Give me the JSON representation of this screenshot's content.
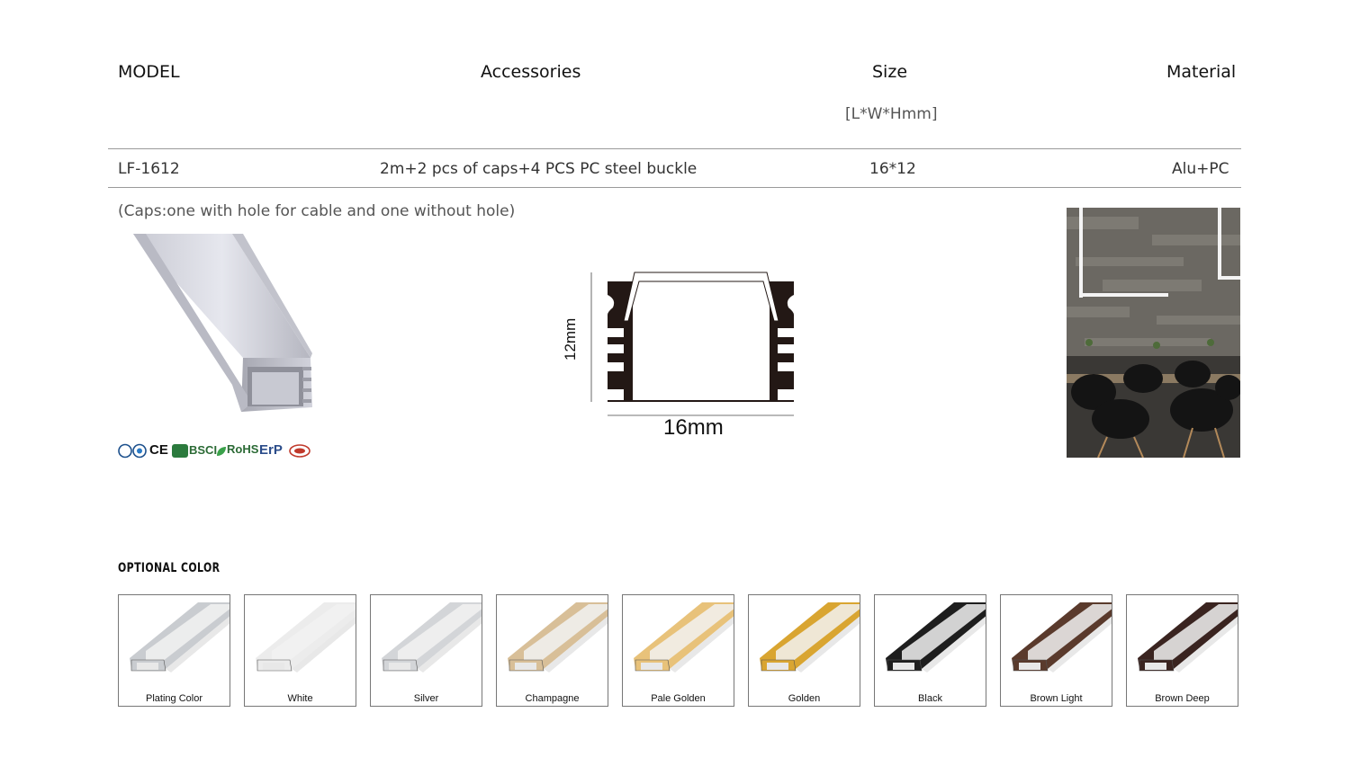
{
  "table": {
    "headers": {
      "model": "MODEL",
      "accessories": "Accessories",
      "size": "Size",
      "size_unit": "[L*W*Hmm]",
      "material": "Material"
    },
    "row": {
      "model": "LF-1612",
      "accessories": "2m+2 pcs of caps+4 PCS PC steel buckle",
      "size": "16*12",
      "material": "Alu+PC"
    }
  },
  "note": "(Caps:one with hole for cable and one without hole)",
  "certifications": [
    "CE",
    "BSCI",
    "RoHS",
    "ErP"
  ],
  "drawing": {
    "height_label": "12mm",
    "width_label": "16mm"
  },
  "optional_color": {
    "title": "OPTIONAL COLOR",
    "swatches": [
      {
        "label": "Plating Color",
        "color": "#c9ccd0"
      },
      {
        "label": "White",
        "color": "#ececec"
      },
      {
        "label": "Silver",
        "color": "#d3d5d8"
      },
      {
        "label": "Champagne",
        "color": "#d8bf98"
      },
      {
        "label": "Pale Golden",
        "color": "#e8c27a"
      },
      {
        "label": "Golden",
        "color": "#d9a531"
      },
      {
        "label": "Black",
        "color": "#1e1e1e"
      },
      {
        "label": "Brown Light",
        "color": "#5a3a2c"
      },
      {
        "label": "Brown Deep",
        "color": "#3a2420"
      }
    ]
  }
}
